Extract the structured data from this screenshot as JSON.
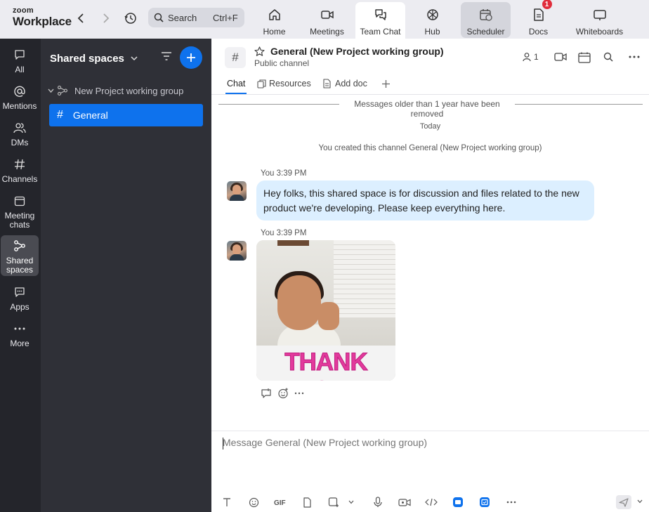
{
  "app": {
    "brand_top": "zoom",
    "brand_bottom": "Workplace"
  },
  "search": {
    "label": "Search",
    "shortcut": "Ctrl+F"
  },
  "top_tabs": [
    {
      "label": "Home",
      "icon": "home-icon"
    },
    {
      "label": "Meetings",
      "icon": "video-camera-icon"
    },
    {
      "label": "Team Chat",
      "icon": "chat-bubbles-icon",
      "active": true
    },
    {
      "label": "Hub",
      "icon": "hub-icon"
    },
    {
      "label": "Scheduler",
      "icon": "calendar-clock-icon"
    },
    {
      "label": "Docs",
      "icon": "document-icon",
      "badge": "1"
    },
    {
      "label": "Whiteboards",
      "icon": "whiteboard-icon"
    }
  ],
  "rail": [
    {
      "label": "All",
      "icon": "chat-icon"
    },
    {
      "label": "Mentions",
      "icon": "at-icon"
    },
    {
      "label": "DMs",
      "icon": "people-icon"
    },
    {
      "label": "Channels",
      "icon": "hash-icon"
    },
    {
      "label": "Meeting chats",
      "icon": "calendar-icon"
    },
    {
      "label": "Shared spaces",
      "icon": "shared-spaces-icon",
      "active": true
    },
    {
      "label": "Apps",
      "icon": "apps-icon"
    },
    {
      "label": "More",
      "icon": "more-icon"
    }
  ],
  "sidebar": {
    "title": "Shared spaces",
    "group": "New Project working group",
    "channel": "General",
    "hash": "#"
  },
  "header": {
    "hash": "#",
    "title": "General (New Project working group)",
    "subtitle": "Public channel",
    "member_count": "1"
  },
  "chat_tabs": [
    "Chat",
    "Resources",
    "Add doc"
  ],
  "messages_area": {
    "older_notice": "Messages older than 1 year have been removed",
    "today": "Today",
    "created": "You created this channel General (New Project working group)"
  },
  "messages": [
    {
      "meta": "You 3:39 PM",
      "text": "Hey folks, this shared space is for discussion and files related to the new product we're developing. Please keep everything here."
    },
    {
      "meta": "You 3:39 PM",
      "gif_text": "THANK YOU!"
    }
  ],
  "composer": {
    "placeholder": "Message General (New Project working group)"
  },
  "colors": {
    "accent": "#0e72ed",
    "rail_bg": "#24252b",
    "sidebar_bg": "#2f3037",
    "bubble": "#dcefff",
    "badge": "#e02d3c"
  }
}
